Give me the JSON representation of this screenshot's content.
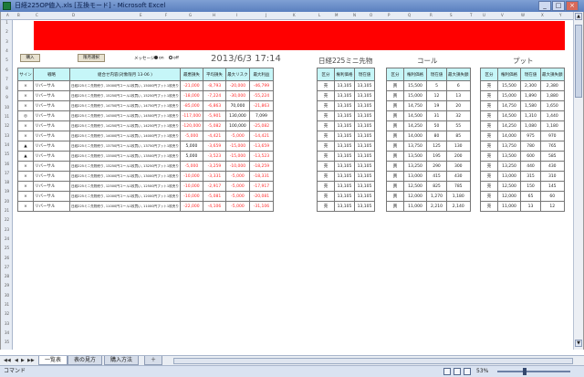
{
  "window": {
    "title": "日経225OP値入.xls [互換モード] - Microsoft Excel",
    "min": "_",
    "max": "□",
    "close": "×"
  },
  "col_letters": [
    "A",
    "B",
    "C",
    "D",
    "E",
    "F",
    "G",
    "H",
    "I",
    "J",
    "K",
    "L",
    "M",
    "N",
    "O",
    "P",
    "Q",
    "R",
    "S",
    "T",
    "U",
    "V",
    "W",
    "X",
    "Y"
  ],
  "row_numbers": [
    "1",
    "2",
    "3",
    "4",
    "5",
    "6",
    "7",
    "8",
    "9",
    "10",
    "11",
    "12",
    "13",
    "14",
    "15",
    "16",
    "17",
    "18",
    "19",
    "20",
    "21",
    "22",
    "23",
    "24",
    "25",
    "26",
    "27",
    "28",
    "29",
    "30",
    "31",
    "32",
    "33",
    "34",
    "35"
  ],
  "controls": {
    "buy_button": "購入",
    "month_button": "限月選択",
    "message_label": "メッセージ",
    "radio_on": "on",
    "radio_off": "off"
  },
  "header": {
    "datetime": "2013/6/3 17:14",
    "instrument": "日経225ミニ先物",
    "call": "コール",
    "put": "プット"
  },
  "table": {
    "headers": [
      "サイン",
      "戦略",
      "組合せ内容(対象限月 13-06 )",
      "最悪損失",
      "平均損失",
      "最大リスク",
      "最大利益",
      "区分",
      "権利価格",
      "現在値",
      "最大損失額",
      "区分",
      "権利価格",
      "現在値",
      "最大損失額",
      "区分",
      "権利価格",
      "現在値",
      "最大損失額"
    ],
    "rows": [
      {
        "sign": "×",
        "strat": "リバーサル",
        "desc": "日経225ミニ先物売り, 15000円コール1枚買い, 15000円プット1枚売り",
        "a": "-21,000",
        "b": "-8,793",
        "c": "-20,000",
        "d": "-46,799",
        "f1": "売",
        "f2": "13,105",
        "f3": "13,105",
        "c1": "買",
        "c2": "15,500",
        "c3": "5",
        "c4": "6",
        "p1": "売",
        "p2": "15,500",
        "p3": "2,300",
        "p4": "2,380"
      },
      {
        "sign": "×",
        "strat": "リバーサル",
        "desc": "日経225ミニ先物売り, 15250円コール1枚買い, 15250円プット1枚売り",
        "a": "-18,000",
        "b": "-7,224",
        "c": "-30,000",
        "d": "-55,224",
        "f1": "売",
        "f2": "13,105",
        "f3": "13,105",
        "c1": "買",
        "c2": "15,000",
        "c3": "12",
        "c4": "13",
        "p1": "売",
        "p2": "15,000",
        "p3": "1,890",
        "p4": "1,880"
      },
      {
        "sign": "×",
        "strat": "リバーサル",
        "desc": "日経225ミニ先物売り, 14750円コール1枚買い, 14750円プット1枚売り",
        "a": "-85,000",
        "b": "-6,863",
        "c": "70,000",
        "d": "-21,863",
        "f1": "売",
        "f2": "13,105",
        "f3": "13,105",
        "c1": "買",
        "c2": "14,750",
        "c3": "19",
        "c4": "20",
        "p1": "売",
        "p2": "14,750",
        "p3": "1,580",
        "p4": "1,650"
      },
      {
        "sign": "◎",
        "strat": "リバーサル",
        "desc": "日経225ミニ先物売り, 14500円コール1枚買い, 14500円プット1枚売り",
        "a": "-117,000",
        "b": "-5,901",
        "c": "130,000",
        "d": "7,099",
        "f1": "売",
        "f2": "13,105",
        "f3": "13,105",
        "c1": "買",
        "c2": "14,500",
        "c3": "31",
        "c4": "32",
        "p1": "売",
        "p2": "14,500",
        "p3": "1,310",
        "p4": "1,440"
      },
      {
        "sign": "×",
        "strat": "リバーサル",
        "desc": "日経225ミニ先物売り, 14250円コール1枚買い, 14250円プット1枚売り",
        "a": "-120,000",
        "b": "-5,082",
        "c": "100,000",
        "d": "-25,082",
        "f1": "売",
        "f2": "13,105",
        "f3": "13,105",
        "c1": "買",
        "c2": "14,250",
        "c3": "50",
        "c4": "55",
        "p1": "売",
        "p2": "14,250",
        "p3": "1,080",
        "p4": "1,180"
      },
      {
        "sign": "×",
        "strat": "リバーサル",
        "desc": "日経225ミニ先物売り, 14000円コール1枚買い, 14000円プット1枚売り",
        "a": "-5,000",
        "b": "-4,421",
        "c": "-5,000",
        "d": "-14,421",
        "f1": "売",
        "f2": "13,105",
        "f3": "13,105",
        "c1": "買",
        "c2": "14,000",
        "c3": "80",
        "c4": "85",
        "p1": "売",
        "p2": "14,000",
        "p3": "975",
        "p4": "970"
      },
      {
        "sign": "▲",
        "strat": "リバーサル",
        "desc": "日経225ミニ先物売り, 13750円コール1枚買い, 13750円プット1枚売り",
        "a": "5,000",
        "b": "-3,659",
        "c": "-15,000",
        "d": "-13,659",
        "f1": "売",
        "f2": "13,105",
        "f3": "13,105",
        "c1": "買",
        "c2": "13,750",
        "c3": "125",
        "c4": "130",
        "p1": "売",
        "p2": "13,750",
        "p3": "780",
        "p4": "765"
      },
      {
        "sign": "▲",
        "strat": "リバーサル",
        "desc": "日経225ミニ先物売り, 13500円コール1枚買い, 13500円プット1枚売り",
        "a": "5,000",
        "b": "-3,523",
        "c": "-15,000",
        "d": "-13,523",
        "f1": "売",
        "f2": "13,105",
        "f3": "13,105",
        "c1": "買",
        "c2": "13,500",
        "c3": "195",
        "c4": "200",
        "p1": "売",
        "p2": "13,500",
        "p3": "600",
        "p4": "585"
      },
      {
        "sign": "×",
        "strat": "リバーサル",
        "desc": "日経225ミニ先物売り, 13250円コール1枚買い, 13250円プット1枚売り",
        "a": "-5,000",
        "b": "-3,259",
        "c": "-10,000",
        "d": "-18,259",
        "f1": "売",
        "f2": "13,105",
        "f3": "13,105",
        "c1": "買",
        "c2": "13,250",
        "c3": "290",
        "c4": "300",
        "p1": "売",
        "p2": "13,250",
        "p3": "440",
        "p4": "430"
      },
      {
        "sign": "×",
        "strat": "リバーサル",
        "desc": "日経225ミニ先物売り, 13000円コール1枚買い, 13000円プット1枚売り",
        "a": "-10,000",
        "b": "-3,331",
        "c": "-5,000",
        "d": "-18,331",
        "f1": "売",
        "f2": "13,105",
        "f3": "13,105",
        "c1": "買",
        "c2": "13,000",
        "c3": "415",
        "c4": "430",
        "p1": "売",
        "p2": "13,000",
        "p3": "315",
        "p4": "310"
      },
      {
        "sign": "×",
        "strat": "リバーサル",
        "desc": "日経225ミニ先物売り, 12500円コール1枚買い, 12500円プット1枚売り",
        "a": "-10,000",
        "b": "-2,917",
        "c": "-5,000",
        "d": "-17,917",
        "f1": "売",
        "f2": "13,105",
        "f3": "13,105",
        "c1": "買",
        "c2": "12,500",
        "c3": "825",
        "c4": "785",
        "p1": "売",
        "p2": "12,500",
        "p3": "150",
        "p4": "145"
      },
      {
        "sign": "×",
        "strat": "リバーサル",
        "desc": "日経225ミニ先物売り, 12000円コール1枚買い, 12000円プット1枚売り",
        "a": "-10,000",
        "b": "-5,081",
        "c": "-5,000",
        "d": "-20,081",
        "f1": "売",
        "f2": "13,105",
        "f3": "13,105",
        "c1": "買",
        "c2": "12,000",
        "c3": "1,270",
        "c4": "1,180",
        "p1": "売",
        "p2": "12,000",
        "p3": "65",
        "p4": "60"
      },
      {
        "sign": "×",
        "strat": "リバーサル",
        "desc": "日経225ミニ先物売り, 11000円コール1枚買い, 11000円プット1枚売り",
        "a": "-22,000",
        "b": "-4,106",
        "c": "-5,000",
        "d": "-31,106",
        "f1": "売",
        "f2": "13,105",
        "f3": "13,105",
        "c1": "買",
        "c2": "11,000",
        "c3": "2,210",
        "c4": "2,140",
        "p1": "売",
        "p2": "11,000",
        "p3": "13",
        "p4": "12"
      }
    ]
  },
  "sheet_tabs": [
    "一覧表",
    "表の見方",
    "購入方法"
  ],
  "status": {
    "mode": "コマンド",
    "zoom": "53%"
  }
}
